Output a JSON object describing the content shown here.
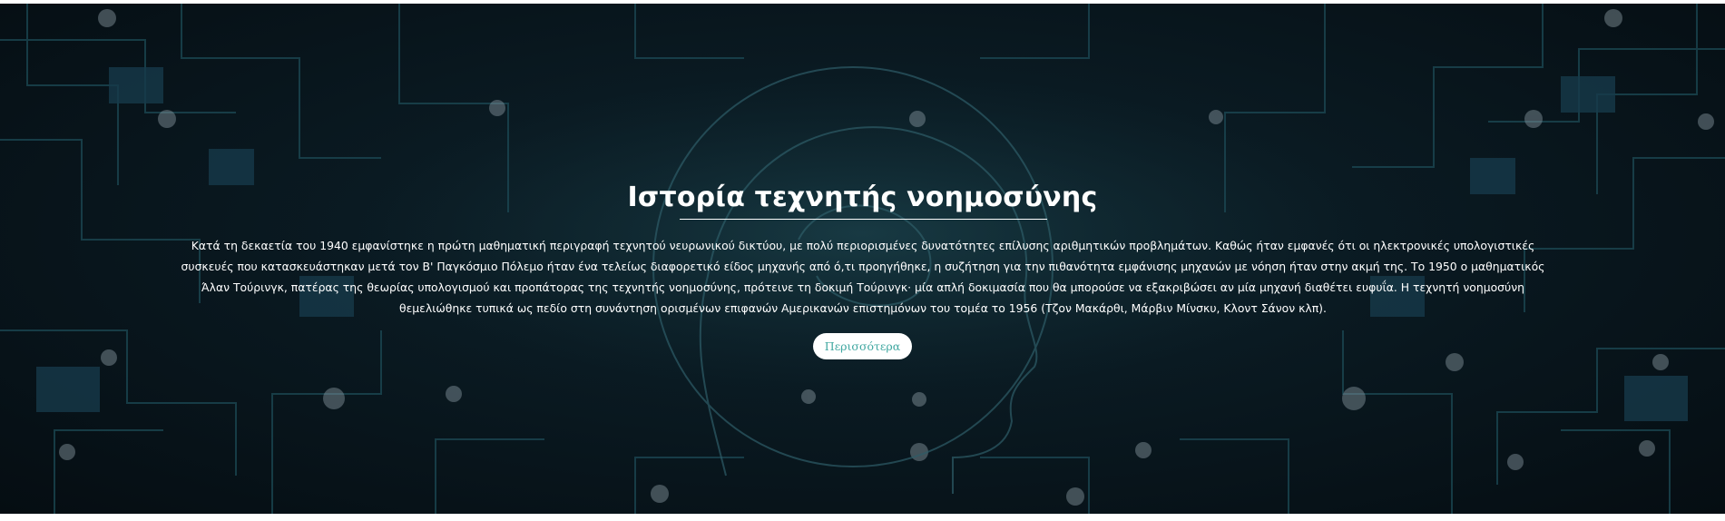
{
  "hero": {
    "title": "Ιστορία τεχνητής νοημοσύνης",
    "body": "Κατά τη δεκαετία του 1940 εμφανίστηκε η πρώτη μαθηματική περιγραφή τεχνητού νευρωνικού δικτύου, με πολύ περιορισμένες δυνατότητες επίλυσης αριθμητικών προβλημάτων. Καθώς ήταν εμφανές ότι οι ηλεκτρονικές υπολογιστικές συσκευές που κατασκευάστηκαν μετά τον Β' Παγκόσμιο Πόλεμο ήταν ένα τελείως διαφορετικό είδος μηχανής από ό,τι προηγήθηκε, η συζήτηση για την πιθανότητα εμφάνισης μηχανών με νόηση ήταν στην ακμή της. Το 1950 ο μαθηματικός Άλαν Τούρινγκ, πατέρας της θεωρίας υπολογισμού και προπάτορας της τεχνητής νοημοσύνης, πρότεινε τη δοκιμή Τούρινγκ· μία απλή δοκιμασία που θα μπορούσε να εξακριβώσει αν μία μηχανή διαθέτει ευφυΐα. Η τεχνητή νοημοσύνη θεμελιώθηκε τυπικά ως πεδίο στη συνάντηση ορισμένων επιφανών Αμερικανών επιστημόνων του τομέα το 1956 (Τζον Μακάρθι, Μάρβιν Μίνσκυ, Κλοντ Σάνον κλπ).",
    "button_label": "Περισσότερα",
    "background_image": "circuit-board-brain-image"
  },
  "colors": {
    "background_dark": "#0a1a22",
    "text": "#ffffff",
    "button_text": "#3fa7a0",
    "button_bg": "#ffffff"
  }
}
